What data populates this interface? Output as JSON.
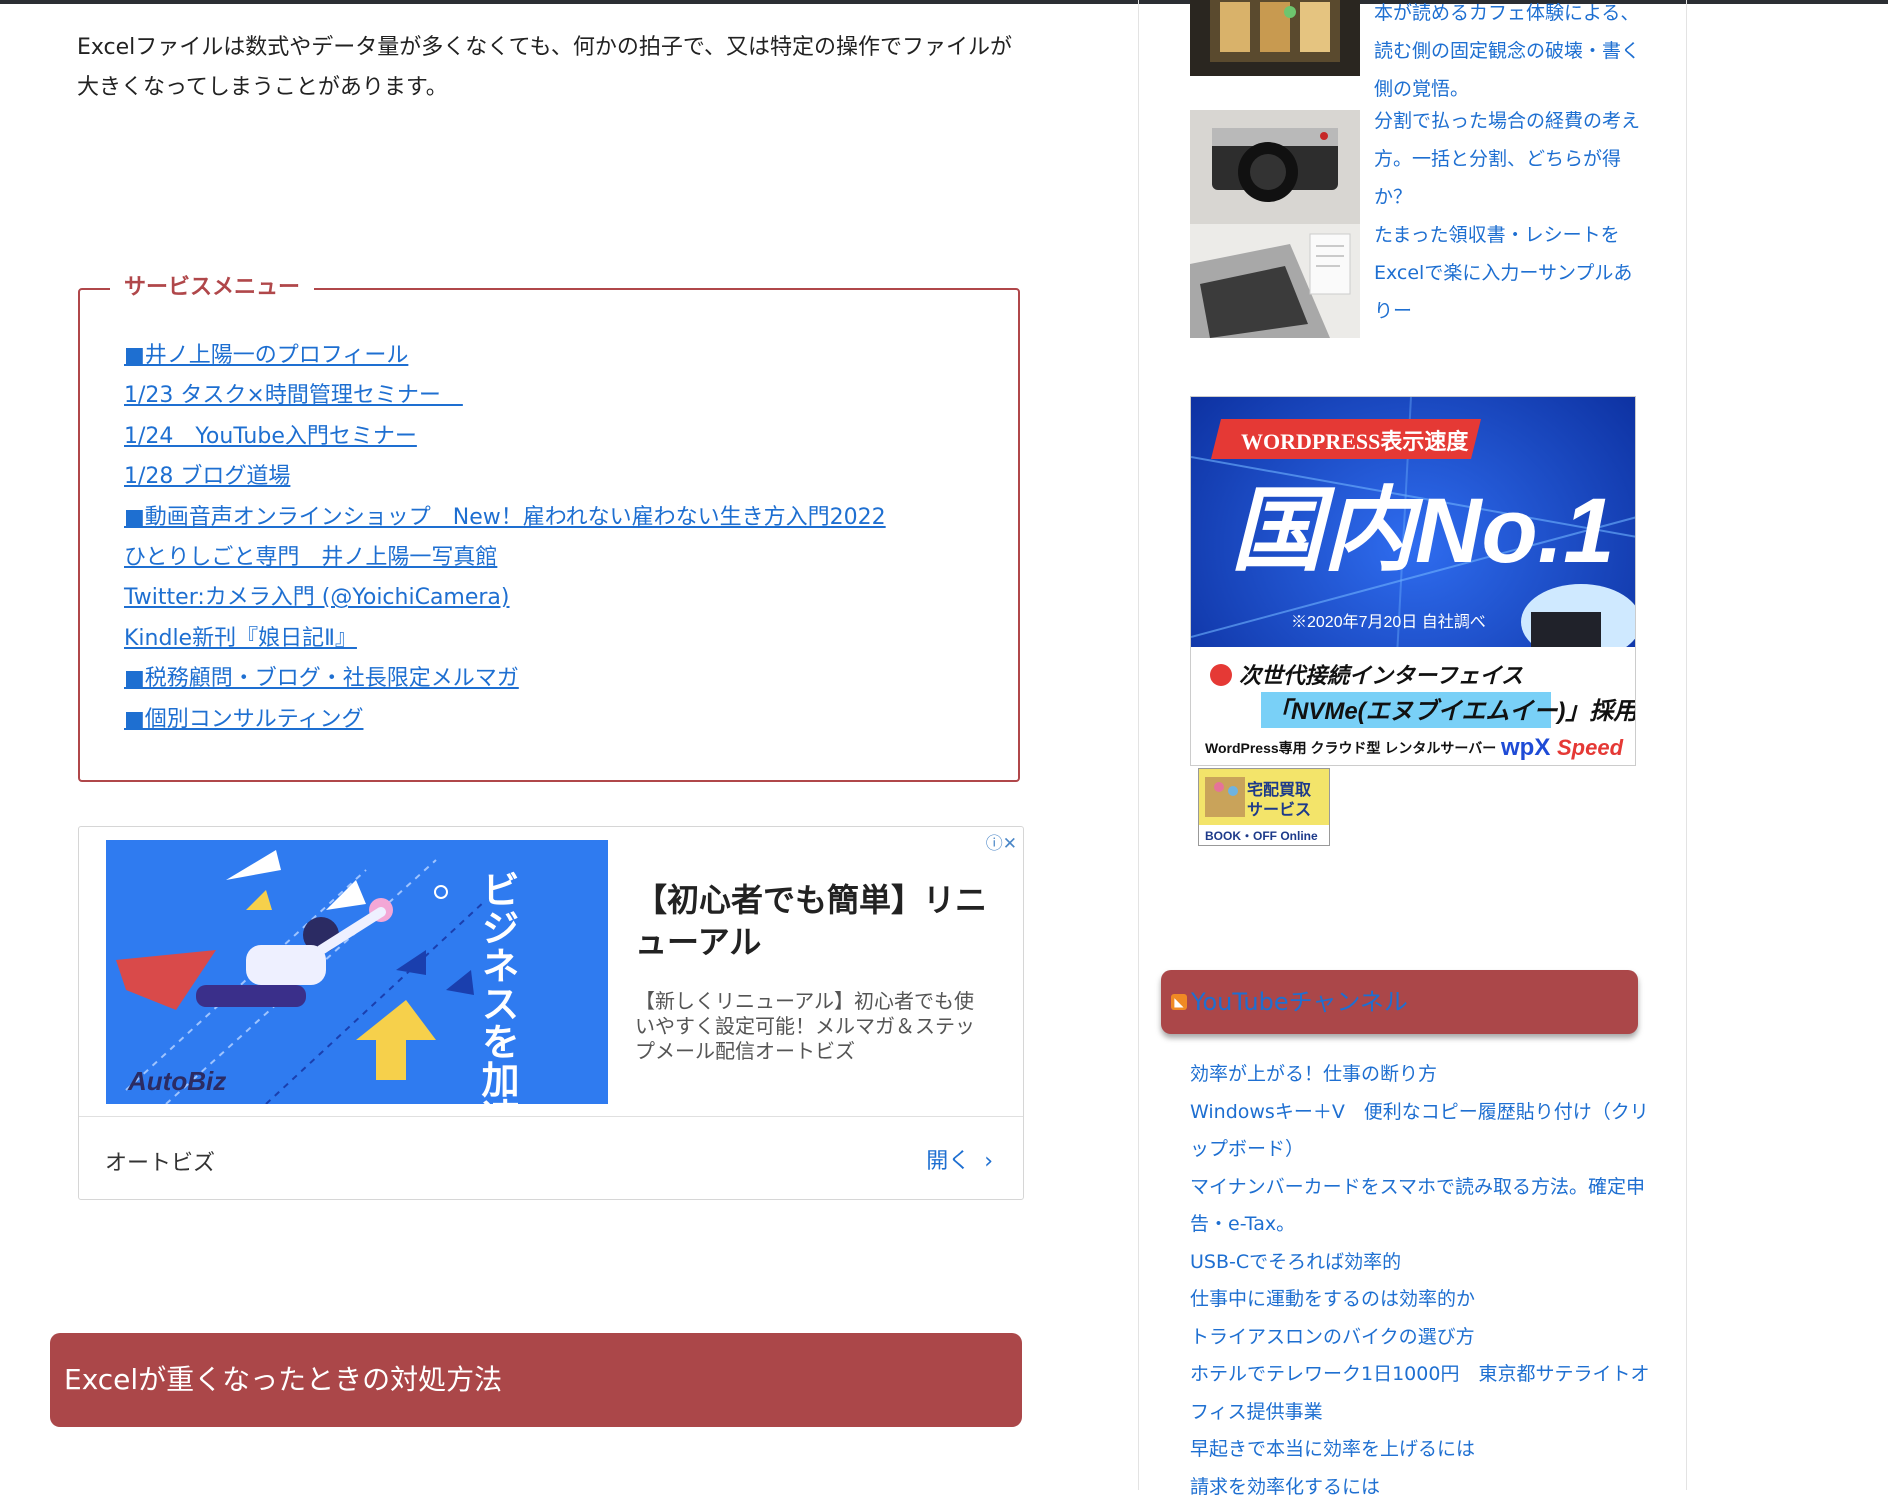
{
  "article": {
    "intro": "Excelファイルは数式やデータ量が多くなくても、何かの拍子で、又は特定の操作でファイルが大きくなってしまうことがあります。",
    "service_menu": {
      "title": "サービスメニュー",
      "items": [
        "■井ノ上陽一のプロフィール",
        "1/23 タスク×時間管理セミナー　",
        "1/24　YouTube入門セミナー",
        "1/28 ブログ道場",
        "■動画音声オンラインショップ　New！雇われない雇わない生き方入門2022",
        "ひとりしごと専門　井ノ上陽一写真館",
        "Twitter:カメラ入門 (@YoichiCamera)",
        "Kindle新刊『娘日記Ⅱ』",
        "■税務顧問・ブログ・社長限定メルマガ",
        "■個別コンサルティング"
      ]
    },
    "ad": {
      "image_text": "ビジネスを加速する",
      "brand": "AutoBiz",
      "headline": "【初心者でも簡単】リニューアル",
      "description": "【新しくリニューアル】初心者でも使いやすく設定可能！メルマガ＆ステップメール配信オートビズ",
      "advertiser": "オートビズ",
      "open_label": "開く",
      "choices_icon": "ⓘ✕"
    },
    "heading": "Excelが重くなったときの対処方法"
  },
  "sidebar": {
    "recent_posts": [
      {
        "title": "本が読めるカフェ体験による、読む側の固定観念の破壊・書く側の覚悟。",
        "thumb": "cafe-photo"
      },
      {
        "title": "分割で払った場合の経費の考え方。一括と分割、どちらが得か？",
        "thumb": "camera-photo"
      },
      {
        "title": "たまった領収書・レシートをExcelで楽に入力ーサンプルありー",
        "thumb": "laptop-receipt-photo"
      }
    ],
    "wpx_ad": {
      "badge": "WORDPRESS表示速度",
      "main": "国内No.1",
      "note": "※2020年7月20日 自社調べ",
      "feature1": "次世代接続インターフェイス",
      "feature2": "「NVMe(エヌブイエムイー)」採用！",
      "footer": "WordPress専用 クラウド型 レンタルサーバー",
      "brand1": "wpX",
      "brand2": "Speed"
    },
    "bookoff": {
      "line1": "宅配買取",
      "line2": "サービス",
      "logo": "BOOK・OFF Online"
    },
    "youtube": {
      "title": "YouTubeチャンネル",
      "items": [
        "効率が上がる！仕事の断り方",
        "Windowsキー＋V　便利なコピー履歴貼り付け（クリップボード）",
        "マイナンバーカードをスマホで読み取る方法。確定申告・e-Tax。",
        "USB-Cでそろれば効率的",
        "仕事中に運動をするのは効率的か",
        "トライアスロンのバイクの選び方",
        "ホテルでテレワーク1日1000円　東京都サテライトオフィス提供事業",
        "早起きで本当に効率を上げるには",
        "請求を効率化するには"
      ]
    }
  }
}
